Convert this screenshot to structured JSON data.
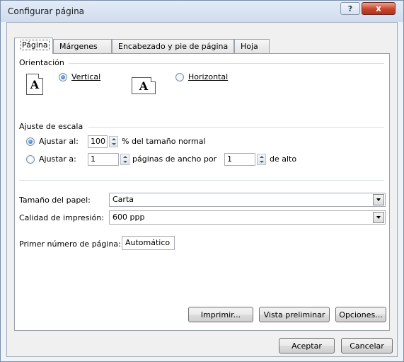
{
  "window": {
    "title": "Configurar página",
    "help_label": "?",
    "close_label": "x"
  },
  "tabs": [
    {
      "label": "Página",
      "active": true
    },
    {
      "label": "Márgenes",
      "active": false
    },
    {
      "label": "Encabezado y pie de página",
      "active": false
    },
    {
      "label": "Hoja",
      "active": false
    }
  ],
  "orientation": {
    "group_label": "Orientación",
    "portrait_label": "Vertical",
    "landscape_label": "Horizontal",
    "icon_letter": "A",
    "selected": "Vertical"
  },
  "scaling": {
    "group_label": "Ajuste de escala",
    "adjust_to_label": "Ajustar al:",
    "adjust_to_value": "100",
    "adjust_to_suffix": "% del tamaño normal",
    "fit_to_label": "Ajustar a:",
    "pages_wide_value": "1",
    "pages_wide_suffix": "páginas de ancho por",
    "pages_tall_value": "1",
    "pages_tall_suffix": "de alto",
    "selected": "Ajustar al:"
  },
  "paper": {
    "size_label": "Tamaño del papel:",
    "size_value": "Carta",
    "quality_label": "Calidad de impresión:",
    "quality_value": "600 ppp",
    "first_page_label": "Primer número de página:",
    "first_page_value": "Automático"
  },
  "buttons": {
    "print": "Imprimir...",
    "preview": "Vista preliminar",
    "options": "Opciones...",
    "ok": "Aceptar",
    "cancel": "Cancelar"
  },
  "colors": {
    "title_bar": "#d6e2f1",
    "close_button": "#c8442c"
  }
}
